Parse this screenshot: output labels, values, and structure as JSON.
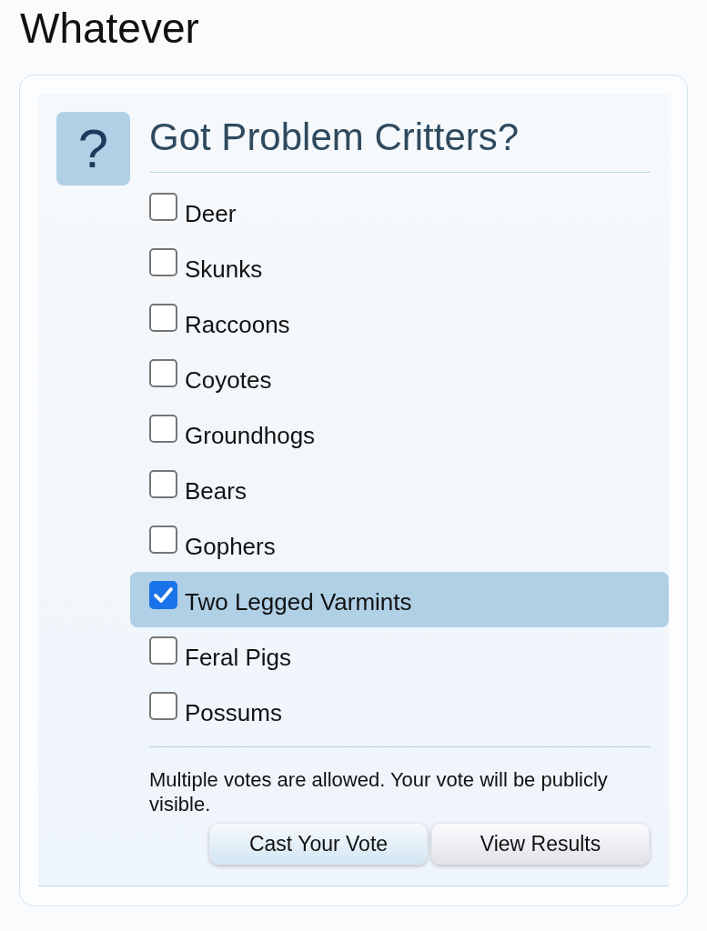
{
  "page": {
    "title": "Whatever"
  },
  "poll": {
    "icon_glyph": "?",
    "question": "Got Problem Critters?",
    "options": [
      {
        "label": "Deer",
        "checked": false
      },
      {
        "label": "Skunks",
        "checked": false
      },
      {
        "label": "Raccoons",
        "checked": false
      },
      {
        "label": "Coyotes",
        "checked": false
      },
      {
        "label": "Groundhogs",
        "checked": false
      },
      {
        "label": "Bears",
        "checked": false
      },
      {
        "label": "Gophers",
        "checked": false
      },
      {
        "label": "Two Legged Varmints",
        "checked": true
      },
      {
        "label": "Feral Pigs",
        "checked": false
      },
      {
        "label": "Possums",
        "checked": false
      }
    ],
    "note": "Multiple votes are allowed. Your vote will be publicly visible.",
    "buttons": [
      {
        "label": "Cast Your Vote",
        "kind": "primary"
      },
      {
        "label": "View Results",
        "kind": "secondary"
      }
    ]
  }
}
